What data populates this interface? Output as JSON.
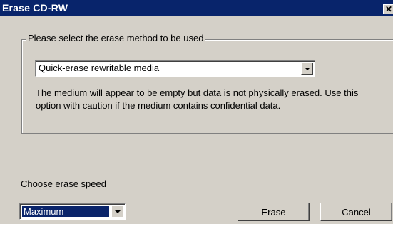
{
  "window": {
    "title": "Erase CD-RW",
    "close_glyph": "✕"
  },
  "erase_method": {
    "group_label": "Please select the erase method to be used",
    "selected": "Quick-erase rewritable media",
    "description": "The medium will appear to be empty but data is not physically erased. Use this option with caution if the medium contains confidential data."
  },
  "erase_speed": {
    "label": "Choose erase speed",
    "selected": "Maximum"
  },
  "buttons": {
    "erase": "Erase",
    "cancel": "Cancel"
  },
  "colors": {
    "titlebar": "#08246b",
    "face": "#d4d0c8",
    "selection": "#0a246a"
  }
}
